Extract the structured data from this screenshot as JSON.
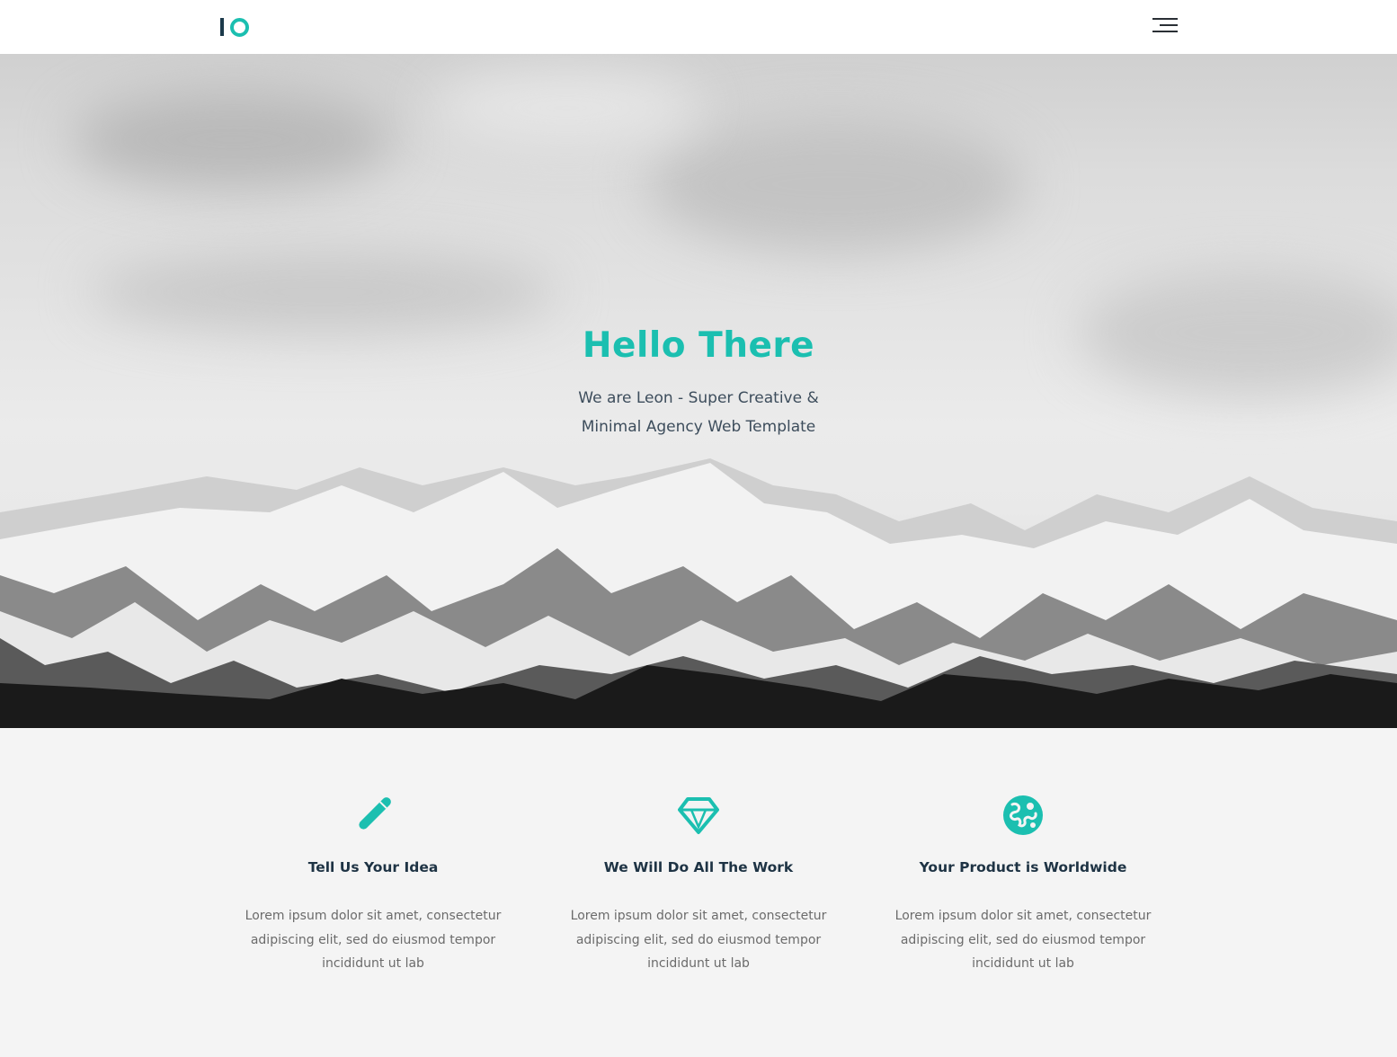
{
  "header": {
    "logo_label": "IO",
    "menu_icon": "hamburger-menu-icon"
  },
  "hero": {
    "title": "Hello There",
    "subtitle": "We are Leon - Super Creative & Minimal Agency Web Template",
    "background_image": "snow-mountains-grayscale"
  },
  "features": [
    {
      "icon": "pencil-icon",
      "title": "Tell Us Your Idea",
      "text": "Lorem ipsum dolor sit amet, consectetur adipiscing elit, sed do eiusmod tempor incididunt ut lab"
    },
    {
      "icon": "diamond-icon",
      "title": "We Will Do All The Work",
      "text": "Lorem ipsum dolor sit amet, consectetur adipiscing elit, sed do eiusmod tempor incididunt ut lab"
    },
    {
      "icon": "globe-icon",
      "title": "Your Product is Worldwide",
      "text": "Lorem ipsum dolor sit amet, consectetur adipiscing elit, sed do eiusmod tempor incididunt ut lab"
    }
  ],
  "colors": {
    "accent": "#1bbfb0",
    "heading": "#1e3344",
    "body_text": "#6b6b6b",
    "section_bg": "#f4f4f4"
  }
}
